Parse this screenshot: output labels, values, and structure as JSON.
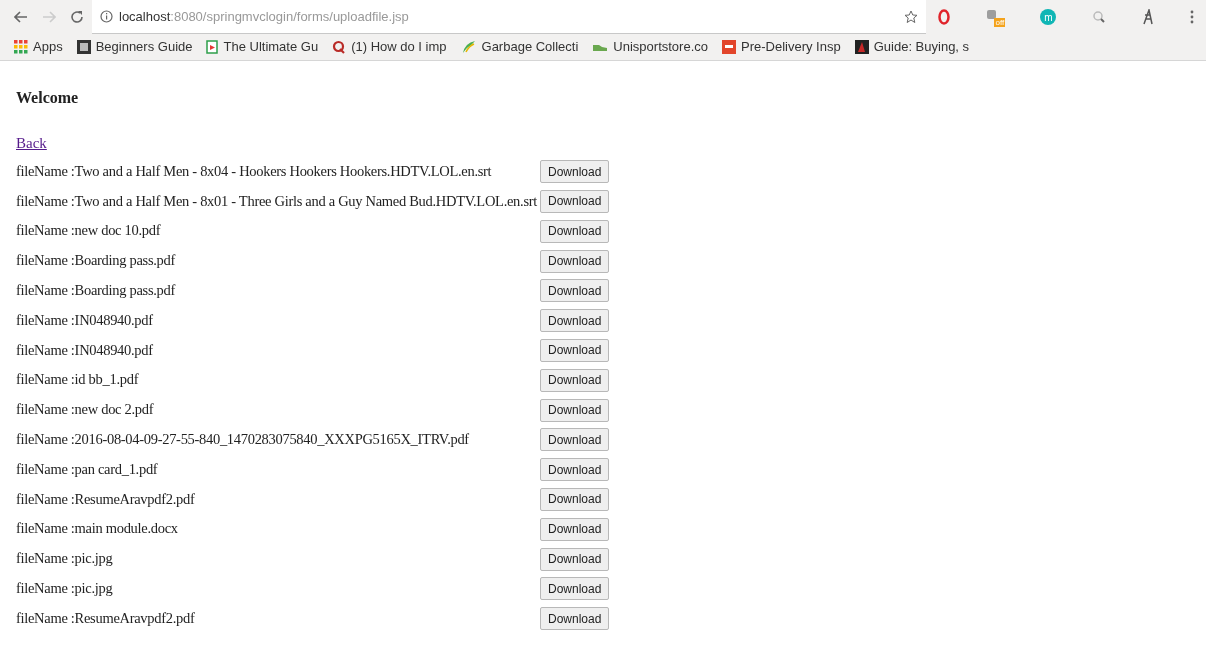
{
  "toolbar": {
    "url_host": "localhost",
    "url_path": ":8080/springmvclogin/forms/uploadfile.jsp",
    "extensions": [
      {
        "kind": "opera"
      },
      {
        "kind": "badge",
        "badge": "off"
      },
      {
        "kind": "letter",
        "letter": "m"
      },
      {
        "kind": "magnifier"
      },
      {
        "kind": "brush"
      }
    ]
  },
  "bookmarks": [
    {
      "kind": "apps",
      "label": "Apps"
    },
    {
      "kind": "book",
      "label": "Beginners Guide"
    },
    {
      "kind": "doc",
      "label": "The Ultimate Gu"
    },
    {
      "kind": "quora",
      "label": "(1) How do I imp"
    },
    {
      "kind": "leaf",
      "label": "Garbage Collecti"
    },
    {
      "kind": "shoe",
      "label": "Unisportstore.co"
    },
    {
      "kind": "zw",
      "label": "Pre-Delivery Insp"
    },
    {
      "kind": "dark",
      "label": "Guide: Buying, s"
    }
  ],
  "page": {
    "heading": "Welcome",
    "back_link": "Back",
    "files": [
      {
        "label": "fileName :Two and a Half Men - 8x04 - Hookers Hookers Hookers.HDTV.LOL.en.srt",
        "button": "Download"
      },
      {
        "label": "fileName :Two and a Half Men - 8x01 - Three Girls and a Guy Named Bud.HDTV.LOL.en.srt",
        "button": "Download"
      },
      {
        "label": "fileName :new doc 10.pdf",
        "button": "Download"
      },
      {
        "label": "fileName :Boarding pass.pdf",
        "button": "Download"
      },
      {
        "label": "fileName :Boarding pass.pdf",
        "button": "Download"
      },
      {
        "label": "fileName :IN048940.pdf",
        "button": "Download"
      },
      {
        "label": "fileName :IN048940.pdf",
        "button": "Download"
      },
      {
        "label": "fileName :id bb_1.pdf",
        "button": "Download"
      },
      {
        "label": "fileName :new doc 2.pdf",
        "button": "Download"
      },
      {
        "label": "fileName :2016-08-04-09-27-55-840_1470283075840_XXXPG5165X_ITRV.pdf",
        "button": "Download"
      },
      {
        "label": "fileName :pan card_1.pdf",
        "button": "Download"
      },
      {
        "label": "fileName :ResumeAravpdf2.pdf",
        "button": "Download"
      },
      {
        "label": "fileName :main module.docx",
        "button": "Download"
      },
      {
        "label": "fileName :pic.jpg",
        "button": "Download"
      },
      {
        "label": "fileName :pic.jpg",
        "button": "Download"
      },
      {
        "label": "fileName :ResumeAravpdf2.pdf",
        "button": "Download"
      }
    ]
  }
}
